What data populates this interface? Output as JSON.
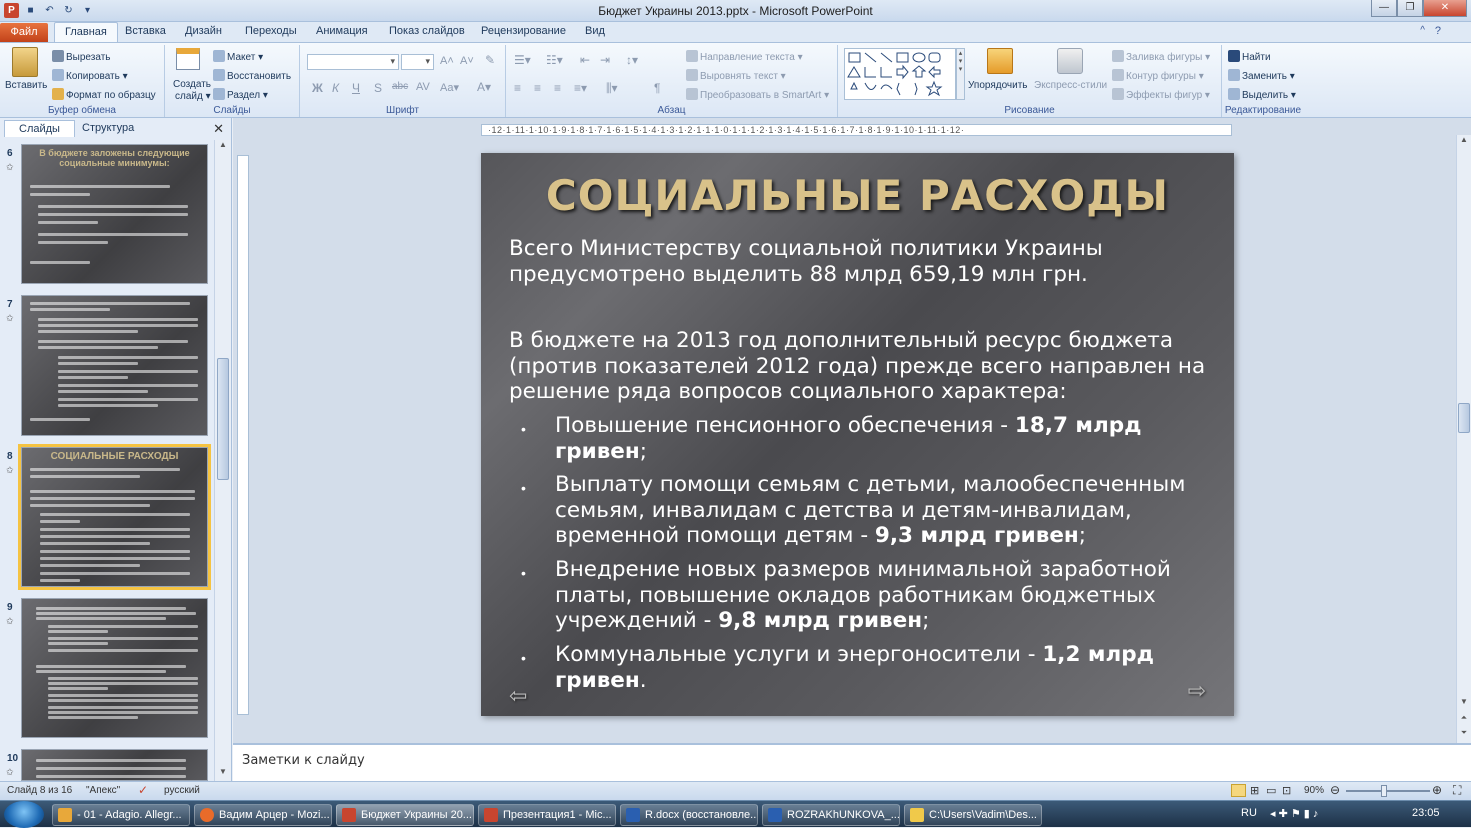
{
  "window": {
    "title": "Бюджет Украины 2013.pptx - Microsoft PowerPoint"
  },
  "tabs": {
    "file": "Файл",
    "items": [
      "Главная",
      "Вставка",
      "Дизайн",
      "Переходы",
      "Анимация",
      "Показ слайдов",
      "Рецензирование",
      "Вид"
    ]
  },
  "ribbon": {
    "clipboard": {
      "paste": "Вставить",
      "cut": "Вырезать",
      "copy": "Копировать",
      "format_painter": "Формат по образцу",
      "label": "Буфер обмена"
    },
    "slides": {
      "create": "Создать",
      "create2": "слайд",
      "layout": "Макет",
      "reset": "Восстановить",
      "section": "Раздел",
      "label": "Слайды"
    },
    "font": {
      "label": "Шрифт"
    },
    "paragraph": {
      "text_direction": "Направление текста",
      "align_text": "Выровнять текст",
      "smartart": "Преобразовать в SmartArt",
      "label": "Абзац"
    },
    "drawing": {
      "arrange": "Упорядочить",
      "quick_styles": "Экспресс-стили",
      "shape_fill": "Заливка фигуры",
      "shape_outline": "Контур фигуры",
      "shape_effects": "Эффекты фигур",
      "label": "Рисование"
    },
    "editing": {
      "find": "Найти",
      "replace": "Заменить",
      "select": "Выделить",
      "label": "Редактирование"
    }
  },
  "panel": {
    "tab_slides": "Слайды",
    "tab_outline": "Структура"
  },
  "thumbnails": [
    {
      "num": "6",
      "title": "В бюджете заложены следующие социальные минимумы:"
    },
    {
      "num": "7",
      "title": ""
    },
    {
      "num": "8",
      "title": "СОЦИАЛЬНЫЕ РАСХОДЫ"
    },
    {
      "num": "9",
      "title": ""
    },
    {
      "num": "10",
      "title": ""
    }
  ],
  "slide": {
    "title": "СОЦИАЛЬНЫЕ РАСХОДЫ",
    "p1": "Всего Министерству социальной политики Украины предусмотрено выделить 88 млрд 659,19 млн грн.",
    "p2": "В бюджете на 2013 год дополнительный ресурс бюджета (против показателей 2012 года) прежде всего направлен на решение ряда вопросов социального характера:",
    "b1": "Повышение пенсионного обеспечения - ",
    "b1b": "18,7 млрд гривен",
    "b1e": ";",
    "b2": "Выплату помощи семьям с детьми, малообеспеченным семьям, инвалидам с детства и детям-инвалидам, временной помощи детям - ",
    "b2b": "9,3 млрд гривен",
    "b2e": ";",
    "b3": "Внедрение новых размеров минимальной заработной платы, повышение окладов работникам бюджетных учреждений - ",
    "b3b": "9,8 млрд гривен",
    "b3e": ";",
    "b4": "Коммунальные услуги и энергоносители - ",
    "b4b": "1,2 млрд гривен",
    "b4e": "."
  },
  "notes": {
    "placeholder": "Заметки к слайду"
  },
  "status": {
    "slide_of": "Слайд 8 из 16",
    "theme": "\"Апекс\"",
    "language": "русский",
    "zoom": "90%"
  },
  "taskbar": {
    "items": [
      "- 01 - Adagio. Allegr...",
      "Вадим Арцер - Mozi...",
      "Бюджет Украины 20...",
      "Презентация1 - Mic...",
      "R.docx (восстановле...",
      "ROZRAKhUNKOVA_...",
      "C:\\Users\\Vadim\\Des..."
    ],
    "lang": "RU",
    "clock": "23:05"
  },
  "colors": {
    "title_gold": "#d9c28a",
    "accent_file": "#c2421a",
    "selected_thumb": "#f5c342"
  }
}
